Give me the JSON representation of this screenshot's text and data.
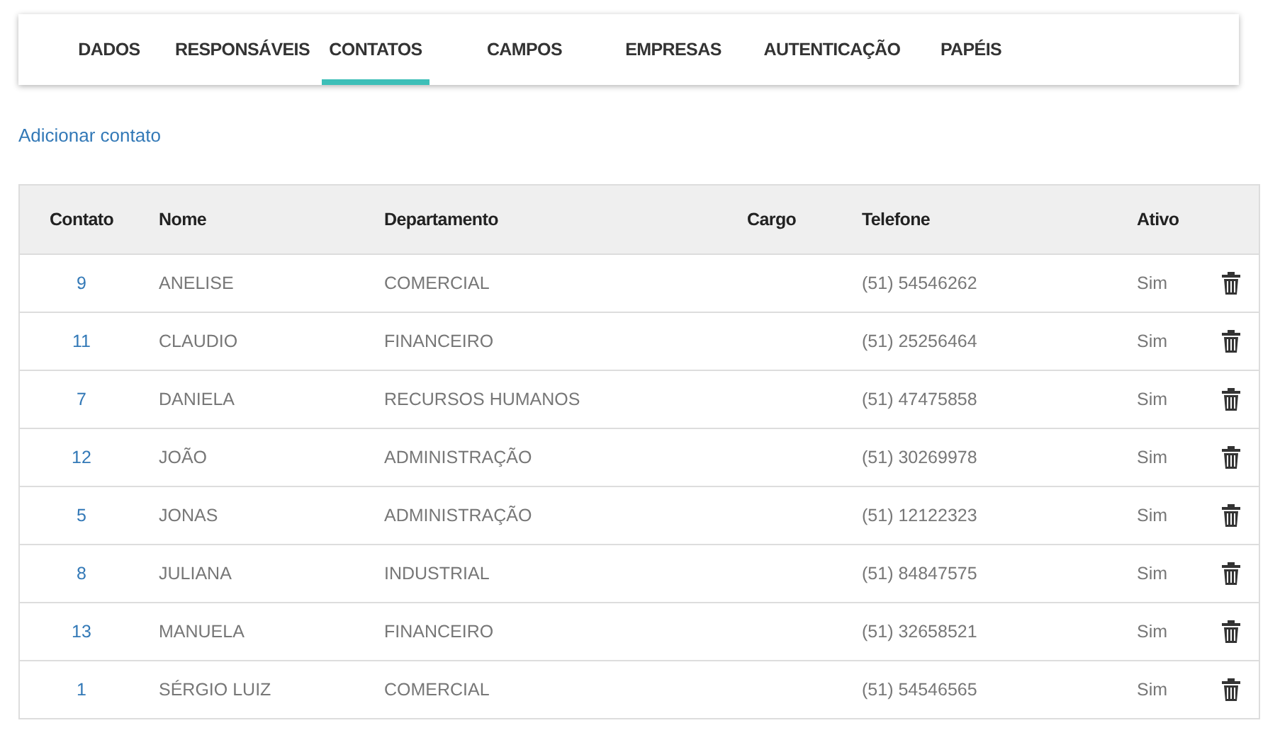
{
  "tabs": [
    {
      "label": "DADOS",
      "selected": false
    },
    {
      "label": "RESPONSÁVEIS",
      "selected": false
    },
    {
      "label": "CONTATOS",
      "selected": true
    },
    {
      "label": "CAMPOS",
      "selected": false
    },
    {
      "label": "EMPRESAS",
      "selected": false
    },
    {
      "label": "AUTENTICAÇÃO",
      "selected": false
    },
    {
      "label": "PAPÉIS",
      "selected": false
    }
  ],
  "add_link": "Adicionar contato",
  "table": {
    "columns": [
      "Contato",
      "Nome",
      "Departamento",
      "Cargo",
      "Telefone",
      "Ativo"
    ],
    "rows": [
      {
        "contato": "9",
        "nome": "ANELISE",
        "departamento": "COMERCIAL",
        "telefone": "(51) 54546262",
        "ativo": "Sim"
      },
      {
        "contato": "11",
        "nome": "CLAUDIO",
        "departamento": "FINANCEIRO",
        "telefone": "(51) 25256464",
        "ativo": "Sim"
      },
      {
        "contato": "7",
        "nome": "DANIELA",
        "departamento": "RECURSOS HUMANOS",
        "telefone": "(51) 47475858",
        "ativo": "Sim"
      },
      {
        "contato": "12",
        "nome": "JOÃO",
        "departamento": "ADMINISTRAÇÃO",
        "telefone": "(51) 30269978",
        "ativo": "Sim"
      },
      {
        "contato": "5",
        "nome": "JONAS",
        "departamento": "ADMINISTRAÇÃO",
        "telefone": "(51) 12122323",
        "ativo": "Sim"
      },
      {
        "contato": "8",
        "nome": "JULIANA",
        "departamento": "INDUSTRIAL",
        "telefone": "(51) 84847575",
        "ativo": "Sim"
      },
      {
        "contato": "13",
        "nome": "MANUELA",
        "departamento": "FINANCEIRO",
        "telefone": "(51) 32658521",
        "ativo": "Sim"
      },
      {
        "contato": "1",
        "nome": "SÉRGIO LUIZ",
        "departamento": "COMERCIAL",
        "telefone": "(51) 54546565",
        "ativo": "Sim"
      }
    ]
  }
}
